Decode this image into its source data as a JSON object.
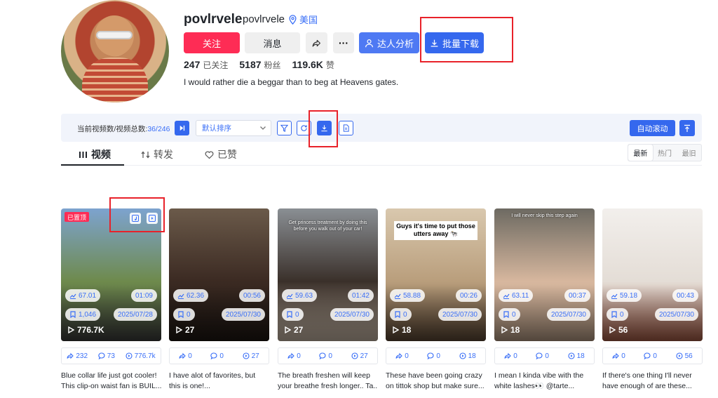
{
  "profile": {
    "username": "povlrvele",
    "handle": "povlrvele",
    "location": "美国",
    "follow_label": "关注",
    "message_label": "消息",
    "more_label": "···",
    "analysis_label": "达人分析",
    "batch_download_label": "批量下载",
    "stats": [
      {
        "value": "247",
        "label": "已关注"
      },
      {
        "value": "5187",
        "label": "粉丝"
      },
      {
        "value": "119.6K",
        "label": "赞"
      }
    ],
    "bio": "I would rather die a beggar than to beg at Heavens gates."
  },
  "toolbar": {
    "count_prefix": "当前视频数/视频总数:",
    "count_value": "36/246",
    "sort_value": "默认排序",
    "auto_scroll_label": "自动滚动"
  },
  "tabs": [
    {
      "label": "视频",
      "icon": "grid-icon",
      "active": true
    },
    {
      "label": "转发",
      "icon": "repost-icon",
      "active": false
    },
    {
      "label": "已赞",
      "icon": "heart-icon",
      "active": false
    }
  ],
  "sort_segments": [
    "最新",
    "热门",
    "最旧"
  ],
  "videos": [
    {
      "pinned_label": "已置顶",
      "score": "67.01",
      "duration": "01:09",
      "favorites": "1,046",
      "date": "2025/07/28",
      "plays": "776.7K",
      "shares": "232",
      "comments": "73",
      "views": "776.7k",
      "desc1": "Blue collar life just got cooler!",
      "desc2": "This clip-on waist fan is BUIL...",
      "overlay": "",
      "thumb_colors": [
        "#7da3cf",
        "#6e8a4c",
        "#3b3b3b"
      ]
    },
    {
      "pinned_label": "",
      "score": "62.36",
      "duration": "00:56",
      "favorites": "0",
      "date": "2025/07/30",
      "plays": "27",
      "shares": "0",
      "comments": "0",
      "views": "27",
      "desc1": "I have alot of favorites, but",
      "desc2": "this is one!...",
      "overlay": "",
      "thumb_colors": [
        "#6b5a4a",
        "#3b2a22",
        "#1d1612"
      ]
    },
    {
      "pinned_label": "",
      "score": "59.63",
      "duration": "01:42",
      "favorites": "0",
      "date": "2025/07/30",
      "plays": "27",
      "shares": "0",
      "comments": "0",
      "views": "27",
      "desc1": "The breath freshen will keep",
      "desc2": "your breathe fresh longer.. Ta...",
      "overlay": "Get princess treatment by doing this before you walk out of your car!",
      "thumb_colors": [
        "#8a8f94",
        "#3a302a",
        "#c7b7a6"
      ]
    },
    {
      "pinned_label": "",
      "score": "58.88",
      "duration": "00:26",
      "favorites": "0",
      "date": "2025/07/30",
      "plays": "18",
      "shares": "0",
      "comments": "0",
      "views": "18",
      "desc1": "These have been going crazy",
      "desc2": "on tittok shop but make sure...",
      "overlay_box": "Guys it's time to put those utters away 🐄",
      "thumb_colors": [
        "#d9c8ae",
        "#b99e7c",
        "#5a4634"
      ]
    },
    {
      "pinned_label": "",
      "score": "63.11",
      "duration": "00:37",
      "favorites": "0",
      "date": "2025/07/30",
      "plays": "18",
      "shares": "0",
      "comments": "0",
      "views": "18",
      "desc1": "I mean I kinda vibe with the",
      "desc2": "white lashes👀 @tarte...",
      "overlay": "I will never skip this step again",
      "thumb_colors": [
        "#6d6a62",
        "#d7b79e",
        "#b59a84"
      ]
    },
    {
      "pinned_label": "",
      "score": "59.18",
      "duration": "00:43",
      "favorites": "0",
      "date": "2025/07/30",
      "plays": "56",
      "shares": "0",
      "comments": "0",
      "views": "56",
      "desc1": "If there's one thing I'll never",
      "desc2": "have enough of are these...",
      "overlay": "",
      "thumb_colors": [
        "#f2efec",
        "#e4ddd6",
        "#a45b45"
      ]
    }
  ]
}
